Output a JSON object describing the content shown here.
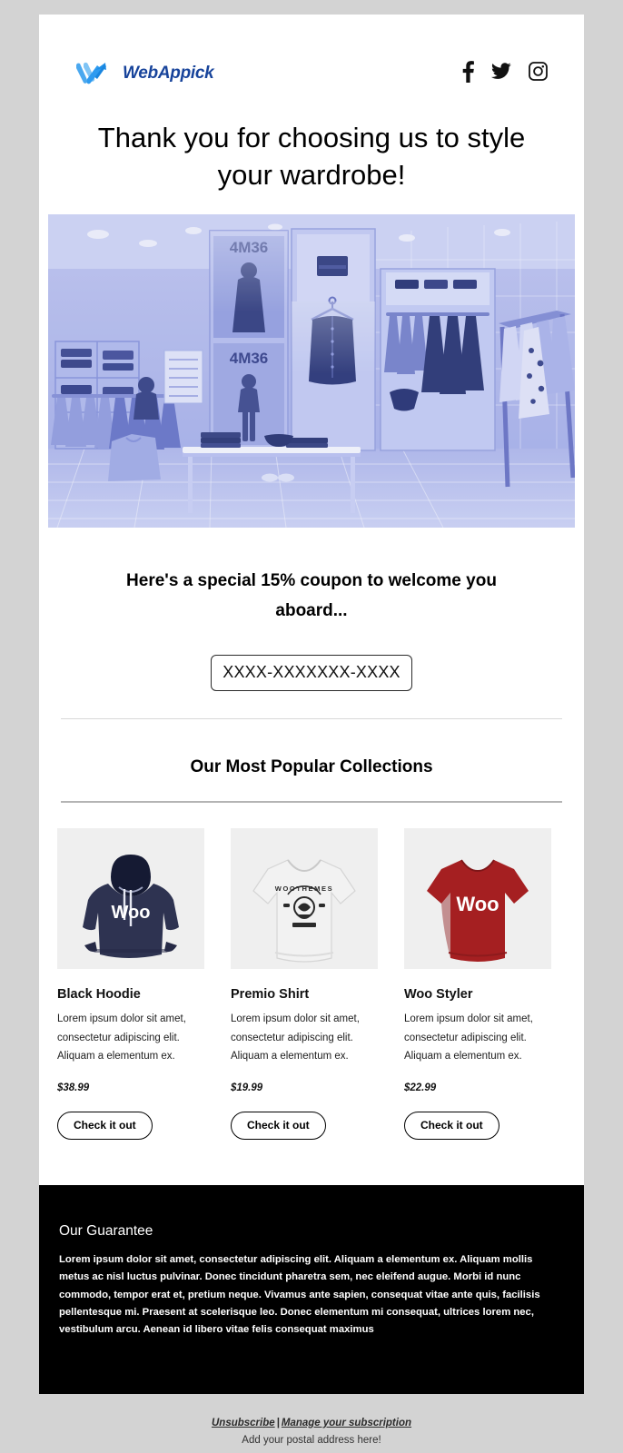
{
  "brand": {
    "logo_text": "WebAppick",
    "logo_icon": "webappick-w-logo",
    "accent_blue": "#2f9bf0",
    "logo_navy": "#18449b"
  },
  "header": {
    "social": [
      {
        "name": "facebook-icon",
        "label": "Facebook"
      },
      {
        "name": "twitter-icon",
        "label": "Twitter"
      },
      {
        "name": "instagram-icon",
        "label": "Instagram"
      }
    ]
  },
  "headline": {
    "line1": "Thank you for choosing us to style",
    "line2": "your wardrobe!"
  },
  "hero": {
    "alt": "Blue duotone photo of a retail clothing store interior with racks, shelves and 4M36 signage",
    "tint": "#6d7ed8",
    "sign_text": "4M36"
  },
  "coupon": {
    "heading_line1": "Here's a special 15% coupon to welcome you",
    "heading_line2": "aboard...",
    "code": "XXXX-XXXXXXX-XXXX",
    "discount": "15%"
  },
  "collections": {
    "title": "Our Most Popular Collections",
    "products": [
      {
        "name": "Black Hoodie",
        "description": "Lorem ipsum dolor sit amet, consectetur adipiscing elit. Aliquam a elementum ex.",
        "price": "$38.99",
        "cta": "Check it out",
        "image": "black-hoodie-image",
        "garment_color": "#2e3351",
        "print_text": "Woo"
      },
      {
        "name": "Premio Shirt",
        "description": "Lorem ipsum dolor sit amet, consectetur adipiscing elit. Aliquam a elementum ex.",
        "price": "$19.99",
        "cta": "Check it out",
        "image": "premio-shirt-image",
        "garment_color": "#f2f2f2",
        "print_text": "WOOTHEMES"
      },
      {
        "name": "Woo Styler",
        "description": "Lorem ipsum dolor sit amet, consectetur adipiscing elit. Aliquam a elementum ex.",
        "price": "$22.99",
        "cta": "Check it out",
        "image": "woo-styler-image",
        "garment_color": "#a51f21",
        "print_text": "Woo"
      }
    ]
  },
  "guarantee": {
    "title": "Our Guarantee",
    "text": "Lorem ipsum dolor sit amet, consectetur adipiscing elit. Aliquam a elementum ex. Aliquam mollis metus ac nisl luctus pulvinar. Donec tincidunt pharetra sem, nec eleifend augue. Morbi id nunc commodo, tempor erat et, pretium neque. Vivamus ante sapien, consequat vitae ante quis, facilisis pellentesque mi. Praesent at scelerisque leo. Donec elementum mi consequat, ultrices lorem nec, vestibulum arcu. Aenean id libero vitae felis consequat maximus"
  },
  "footer": {
    "unsubscribe": "Unsubscribe",
    "separator": "|",
    "manage": "Manage your subscription",
    "address": "Add your postal address here!"
  }
}
